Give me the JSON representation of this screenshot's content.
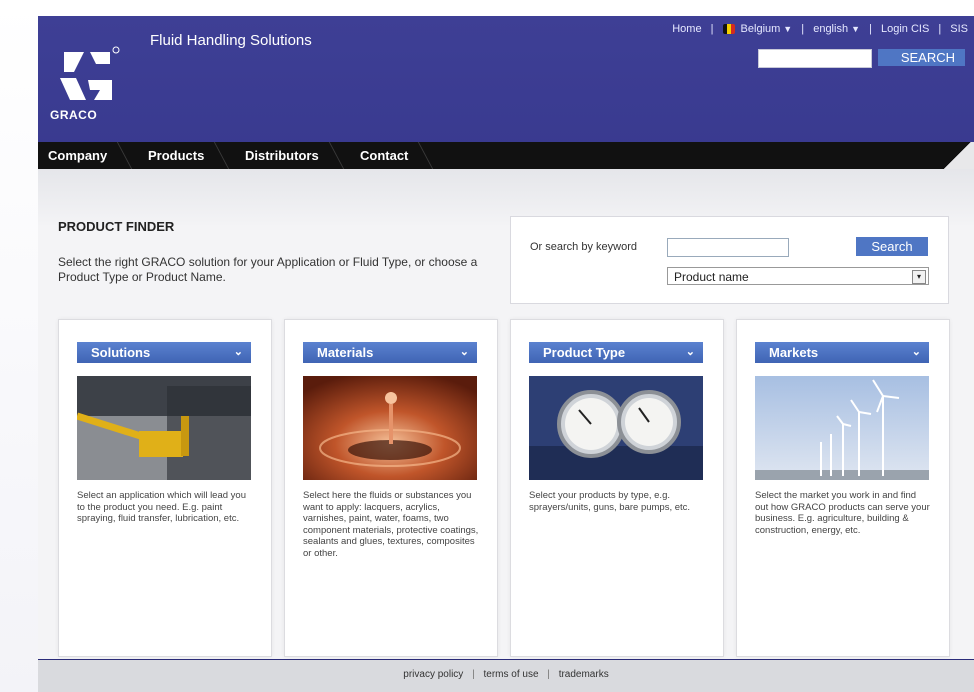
{
  "header": {
    "logo_text": "GRACO",
    "tagline": "Fluid Handling Solutions",
    "links": {
      "home": "Home",
      "country": "Belgium",
      "language": "english",
      "login": "Login CIS",
      "sis": "SIS"
    },
    "search_button": "SEARCH",
    "search_value": ""
  },
  "nav": {
    "items": [
      "Company",
      "Products",
      "Distributors",
      "Contact"
    ]
  },
  "finder": {
    "title": "PRODUCT FINDER",
    "description": "Select the right GRACO solution for your Application or Fluid Type, or choose a Product Type or Product Name.",
    "keyword_label": "Or search by keyword",
    "keyword_value": "",
    "search_button": "Search",
    "select_value": "Product name"
  },
  "cards": [
    {
      "title": "Solutions",
      "text": "Select an application which will lead you to the product you need. E.g. paint spraying, fluid transfer, lubrication, etc."
    },
    {
      "title": "Materials",
      "text": "Select here the fluids or substances you want to apply: lacquers, acrylics, varnishes, paint, water, foams, two component materials, protective coatings, sealants and glues, textures, composites or other."
    },
    {
      "title": "Product Type",
      "text": "Select your products by type, e.g. sprayers/units, guns, bare pumps, etc."
    },
    {
      "title": "Markets",
      "text": "Select the market you work in and find out how GRACO products can serve your business. E.g. agriculture, building & construction, energy, etc."
    }
  ],
  "footer": {
    "links": [
      "privacy policy",
      "terms of use",
      "trademarks"
    ]
  },
  "colors": {
    "header_bg": "#3e3f95",
    "accent_button": "#4f76c4",
    "nav_bg": "#111111"
  }
}
